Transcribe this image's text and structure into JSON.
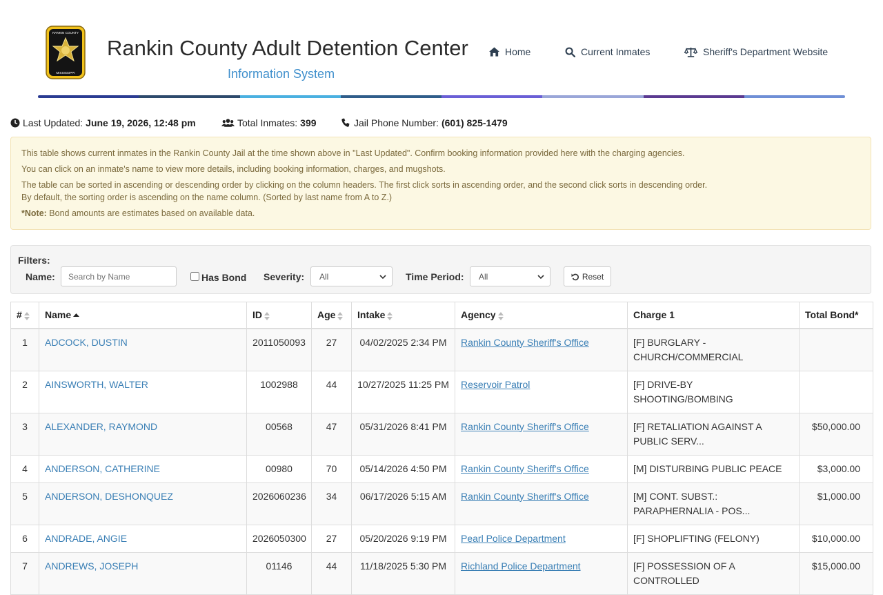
{
  "header": {
    "logo_top": "RANKIN COUNTY",
    "logo_bottom": "MISSISSIPPI",
    "title": "Rankin County Adult Detention Center",
    "subtitle": "Information System",
    "nav": [
      {
        "label": "Home",
        "icon": "home-icon"
      },
      {
        "label": "Current Inmates",
        "icon": "search-icon"
      },
      {
        "label": "Sheriff's Department Website",
        "icon": "scale-icon"
      }
    ],
    "stripe_colors": [
      "#2a3b92",
      "#2d4a6c",
      "#4ab0e0",
      "#2f5d8a",
      "#6a5fd6",
      "#9aa6d8",
      "#5b3a91",
      "#6f8fd6"
    ]
  },
  "info": {
    "last_updated_label": "Last Updated:",
    "last_updated_value": "June 19, 2026, 12:48 pm",
    "total_label": "Total Inmates:",
    "total_value": "399",
    "phone_label": "Jail Phone Number:",
    "phone_value": "(601) 825-1479"
  },
  "notice": {
    "line1": "This table shows current inmates in the Rankin County Jail at the time shown above in \"Last Updated\". Confirm booking information provided here with the charging agencies.",
    "line2": "You can click on an inmate's name to view more details, including booking information, charges, and mugshots.",
    "line3": "The table can be sorted in ascending or descending order by clicking on the column headers. The first click sorts in ascending order, and the second click sorts in descending order.",
    "line4": "By default, the sorting order is ascending on the name column. (Sorted by last name from A to Z.)",
    "note_label": "*Note:",
    "note_text": "Bond amounts are estimates based on available data."
  },
  "filters": {
    "title": "Filters:",
    "name_label": "Name:",
    "name_placeholder": "Search by Name",
    "has_bond_label": "Has Bond",
    "severity_label": "Severity:",
    "severity_value": "All",
    "time_label": "Time Period:",
    "time_value": "All",
    "reset_label": "Reset"
  },
  "table": {
    "headers": [
      "#",
      "Name",
      "ID",
      "Age",
      "Intake",
      "Agency",
      "Charge 1",
      "Total Bond*"
    ],
    "rows": [
      {
        "num": "1",
        "name": "ADCOCK, DUSTIN",
        "id": "2011050093",
        "age": "27",
        "intake": "04/02/2025 2:34 PM",
        "agency": "Rankin County Sheriff's Office",
        "charge": "[F] BURGLARY - CHURCH/COMMERCIAL",
        "bond": ""
      },
      {
        "num": "2",
        "name": "AINSWORTH, WALTER",
        "id": "1002988",
        "age": "44",
        "intake": "10/27/2025 11:25 PM",
        "agency": "Reservoir Patrol",
        "charge": "[F] DRIVE-BY SHOOTING/BOMBING",
        "bond": ""
      },
      {
        "num": "3",
        "name": "ALEXANDER, RAYMOND",
        "id": "00568",
        "age": "47",
        "intake": "05/31/2026 8:41 PM",
        "agency": "Rankin County Sheriff's Office",
        "charge": "[F] RETALIATION AGAINST A PUBLIC SERV...",
        "bond": "$50,000.00"
      },
      {
        "num": "4",
        "name": "ANDERSON, CATHERINE",
        "id": "00980",
        "age": "70",
        "intake": "05/14/2026 4:50 PM",
        "agency": "Rankin County Sheriff's Office",
        "charge": "[M] DISTURBING PUBLIC PEACE",
        "bond": "$3,000.00"
      },
      {
        "num": "5",
        "name": "ANDERSON, DESHONQUEZ",
        "id": "2026060236",
        "age": "34",
        "intake": "06/17/2026 5:15 AM",
        "agency": "Rankin County Sheriff's Office",
        "charge": "[M] CONT. SUBST.: PARAPHERNALIA - POS...",
        "bond": "$1,000.00"
      },
      {
        "num": "6",
        "name": "ANDRADE, ANGIE",
        "id": "2026050300",
        "age": "27",
        "intake": "05/20/2026 9:19 PM",
        "agency": "Pearl Police Department",
        "charge": "[F] SHOPLIFTING (FELONY)",
        "bond": "$10,000.00"
      },
      {
        "num": "7",
        "name": "ANDREWS, JOSEPH",
        "id": "01146",
        "age": "44",
        "intake": "11/18/2025 5:30 PM",
        "agency": "Richland Police Department",
        "charge": "[F] POSSESSION OF A CONTROLLED",
        "bond": "$15,000.00"
      }
    ]
  }
}
